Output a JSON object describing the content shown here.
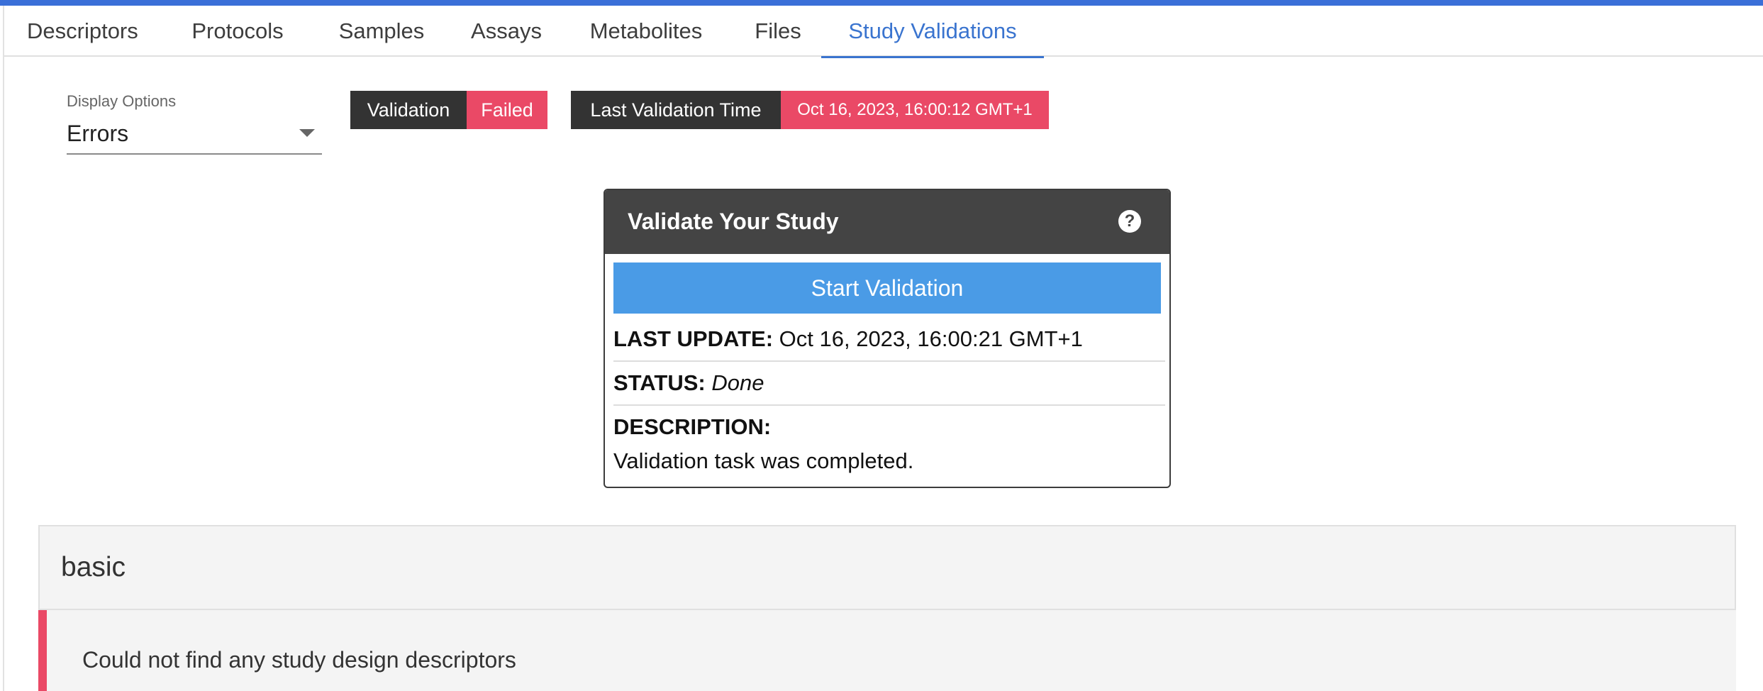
{
  "tabs": [
    {
      "label": "Descriptors"
    },
    {
      "label": "Protocols"
    },
    {
      "label": "Samples"
    },
    {
      "label": "Assays"
    },
    {
      "label": "Metabolites"
    },
    {
      "label": "Files"
    },
    {
      "label": "Study Validations",
      "active": true
    }
  ],
  "display_options": {
    "label": "Display Options",
    "selected": "Errors"
  },
  "badges": {
    "validation_label": "Validation",
    "validation_status": "Failed",
    "last_time_label": "Last Validation Time",
    "last_time_value": "Oct 16, 2023, 16:00:12 GMT+1"
  },
  "card": {
    "title": "Validate Your Study",
    "help_symbol": "?",
    "start_button": "Start Validation",
    "last_update_label": "LAST UPDATE:",
    "last_update_value": "Oct 16, 2023, 16:00:21 GMT+1",
    "status_label": "STATUS:",
    "status_value": "Done",
    "description_label": "DESCRIPTION:",
    "description_value": "Validation task was completed."
  },
  "section": {
    "title": "basic",
    "errors": [
      "Could not find any study design descriptors"
    ]
  },
  "colors": {
    "accent_blue": "#3a74cf",
    "button_blue": "#4a9be6",
    "error_red": "#ea4966",
    "dark_badge": "#333333"
  }
}
